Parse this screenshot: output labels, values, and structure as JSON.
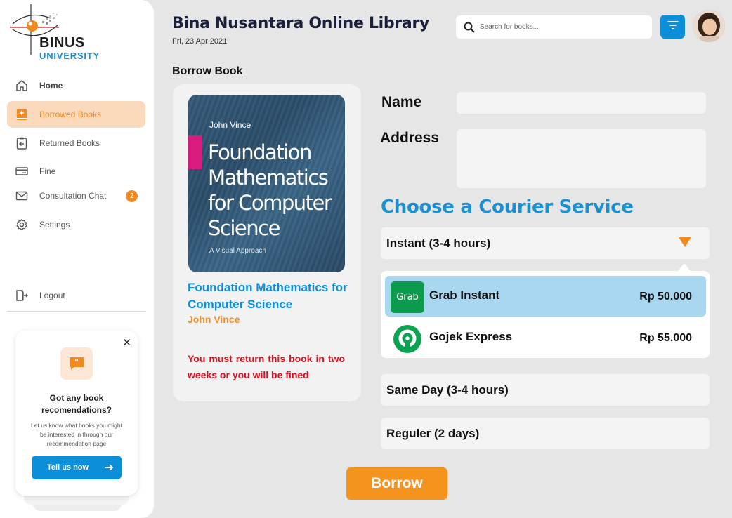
{
  "brand": {
    "line1": "BINUS",
    "line2": "UNIVERSITY"
  },
  "header": {
    "title": "Bina Nusantara Online Library",
    "date": "Fri, 23 Apr 2021",
    "search_placeholder": "Search for books..."
  },
  "sidebar": {
    "items": [
      {
        "label": "Home",
        "icon": "home-icon"
      },
      {
        "label": "Borrowed Books",
        "icon": "borrowed-book-icon",
        "active": true
      },
      {
        "label": "Returned Books",
        "icon": "returned-book-icon"
      },
      {
        "label": "Fine",
        "icon": "fine-card-icon"
      },
      {
        "label": "Consultation Chat",
        "icon": "mail-icon",
        "badge": "2"
      },
      {
        "label": "Settings",
        "icon": "gear-icon"
      }
    ],
    "logout": "Logout"
  },
  "promo": {
    "title": "Got any book recomendations?",
    "description": "Let us know what books you might be interested in through our recommendation page",
    "button": "Tell us now"
  },
  "page": {
    "section_title": "Borrow Book"
  },
  "book": {
    "cover_author": "John Vince",
    "cover_title": "Foundation Mathematics for Computer Science",
    "cover_subtitle": "A Visual Approach",
    "title": "Foundation Mathematics for Computer Science",
    "author": "John Vince",
    "warning": "You must return this book in two weeks or you will be fined"
  },
  "form": {
    "name_label": "Name",
    "name_value": "",
    "address_label": "Address",
    "address_value": "",
    "courier_title": "Choose a Courier Service",
    "services": [
      {
        "label": "Instant (3-4 hours)",
        "expanded": true
      },
      {
        "label": "Same Day (3-4 hours)"
      },
      {
        "label": "Reguler (2 days)"
      }
    ],
    "options": [
      {
        "name": "Grab Instant",
        "price": "Rp 50.000",
        "logo_text": "Grab",
        "selected": true
      },
      {
        "name": "Gojek Express",
        "price": "Rp 55.000",
        "selected": false
      }
    ],
    "submit": "Borrow"
  },
  "colors": {
    "accent_blue": "#0c8ed9",
    "accent_orange": "#f5931f",
    "warning_red": "#e40c1c",
    "selected_bg": "#a9d7f0",
    "grab_green": "#0c9a4c",
    "gojek_green": "#0aa34f"
  }
}
